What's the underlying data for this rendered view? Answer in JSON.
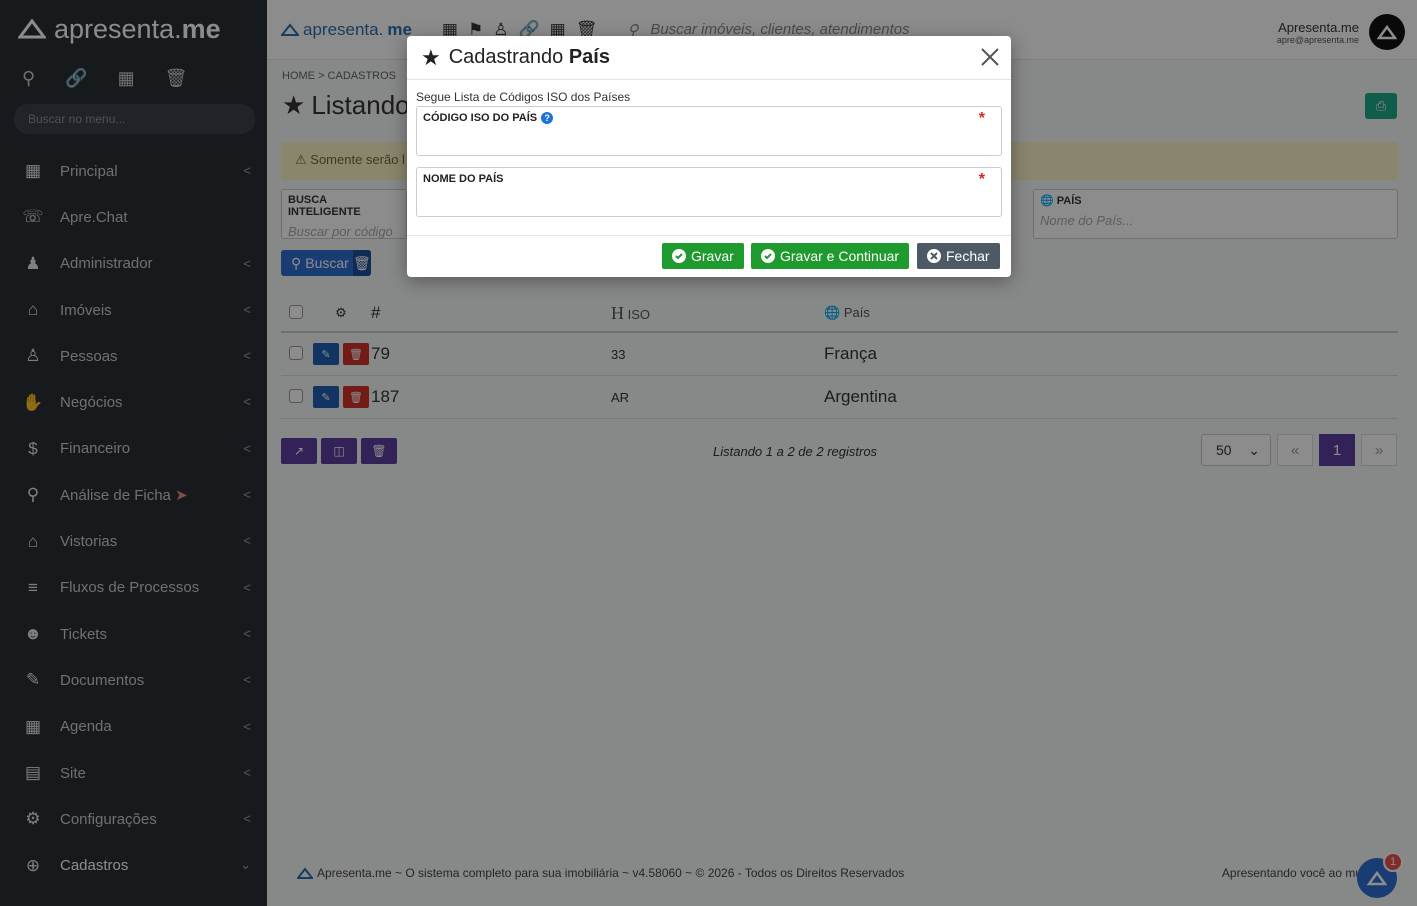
{
  "sidebar": {
    "brand_light": "apresenta.",
    "brand_bold": "me",
    "search_placeholder": "Buscar no menu...",
    "items": [
      {
        "label": "Principal",
        "icon": "dashboard-icon"
      },
      {
        "label": "Apre.Chat",
        "icon": "whatsapp-icon"
      },
      {
        "label": "Administrador",
        "icon": "user-tie-icon"
      },
      {
        "label": "Imóveis",
        "icon": "home-icon"
      },
      {
        "label": "Pessoas",
        "icon": "people-icon"
      },
      {
        "label": "Negócios",
        "icon": "handshake-icon"
      },
      {
        "label": "Financeiro",
        "icon": "dollar-icon"
      },
      {
        "label": "Análise de Ficha",
        "icon": "search-person-icon"
      },
      {
        "label": "Vistorias",
        "icon": "inspection-icon"
      },
      {
        "label": "Fluxos de Processos",
        "icon": "filter-icon"
      },
      {
        "label": "Tickets",
        "icon": "support-icon"
      },
      {
        "label": "Documentos",
        "icon": "document-edit-icon"
      },
      {
        "label": "Agenda",
        "icon": "calendar-clock-icon"
      },
      {
        "label": "Site",
        "icon": "website-icon"
      },
      {
        "label": "Configurações",
        "icon": "gears-icon"
      },
      {
        "label": "Cadastros",
        "icon": "plus-circle-icon"
      }
    ]
  },
  "topbar": {
    "brand_light": "apresenta.",
    "brand_bold": "me",
    "search_placeholder": "Buscar imóveis, clientes, atendimentos",
    "user_name": "Apresenta.me",
    "user_email": "apre@apresenta.me"
  },
  "main": {
    "breadcrumb_home": "HOME",
    "breadcrumb_section": "CADASTROS",
    "page_title": "Listando",
    "warning": "Somente serão l",
    "filters": {
      "smart_label": "BUSCA INTELIGENTE",
      "smart_placeholder": "Buscar por código",
      "country_label": "PAÍS",
      "country_placeholder": "Nome do País..."
    },
    "search_button": "Buscar",
    "table": {
      "col_id": "#",
      "col_iso": "ISO",
      "col_country": "País",
      "rows": [
        {
          "id": "79",
          "iso": "33",
          "country": "França"
        },
        {
          "id": "187",
          "iso": "AR",
          "country": "Argentina"
        }
      ]
    },
    "listing_text": "Listando 1 a 2 de 2 registros",
    "page_size": "50",
    "current_page": "1"
  },
  "footer": {
    "text": "Apresenta.me ~ O sistema completo para sua imobiliária ~ v4.58060 ~ © 2026 - Todos os Direitos Reservados",
    "right_text": "Apresentando você ao mu",
    "chat_badge": "1"
  },
  "modal": {
    "title_prefix": "Cadastrando",
    "title_bold": "País",
    "hint": "Segue Lista de Códigos ISO dos Países",
    "iso_label": "CÓDIGO ISO DO PAÍS",
    "iso_value": "",
    "name_label": "NOME DO PAÍS",
    "name_value": "",
    "btn_save": "Gravar",
    "btn_save_continue": "Gravar e Continuar",
    "btn_close": "Fechar"
  },
  "colors": {
    "sidebar_bg": "#2b3036",
    "accent_purple": "#5b3ea1",
    "save_green": "#1f9a2e",
    "close_gray": "#4d5a66",
    "primary_blue": "#2f6fd1"
  }
}
